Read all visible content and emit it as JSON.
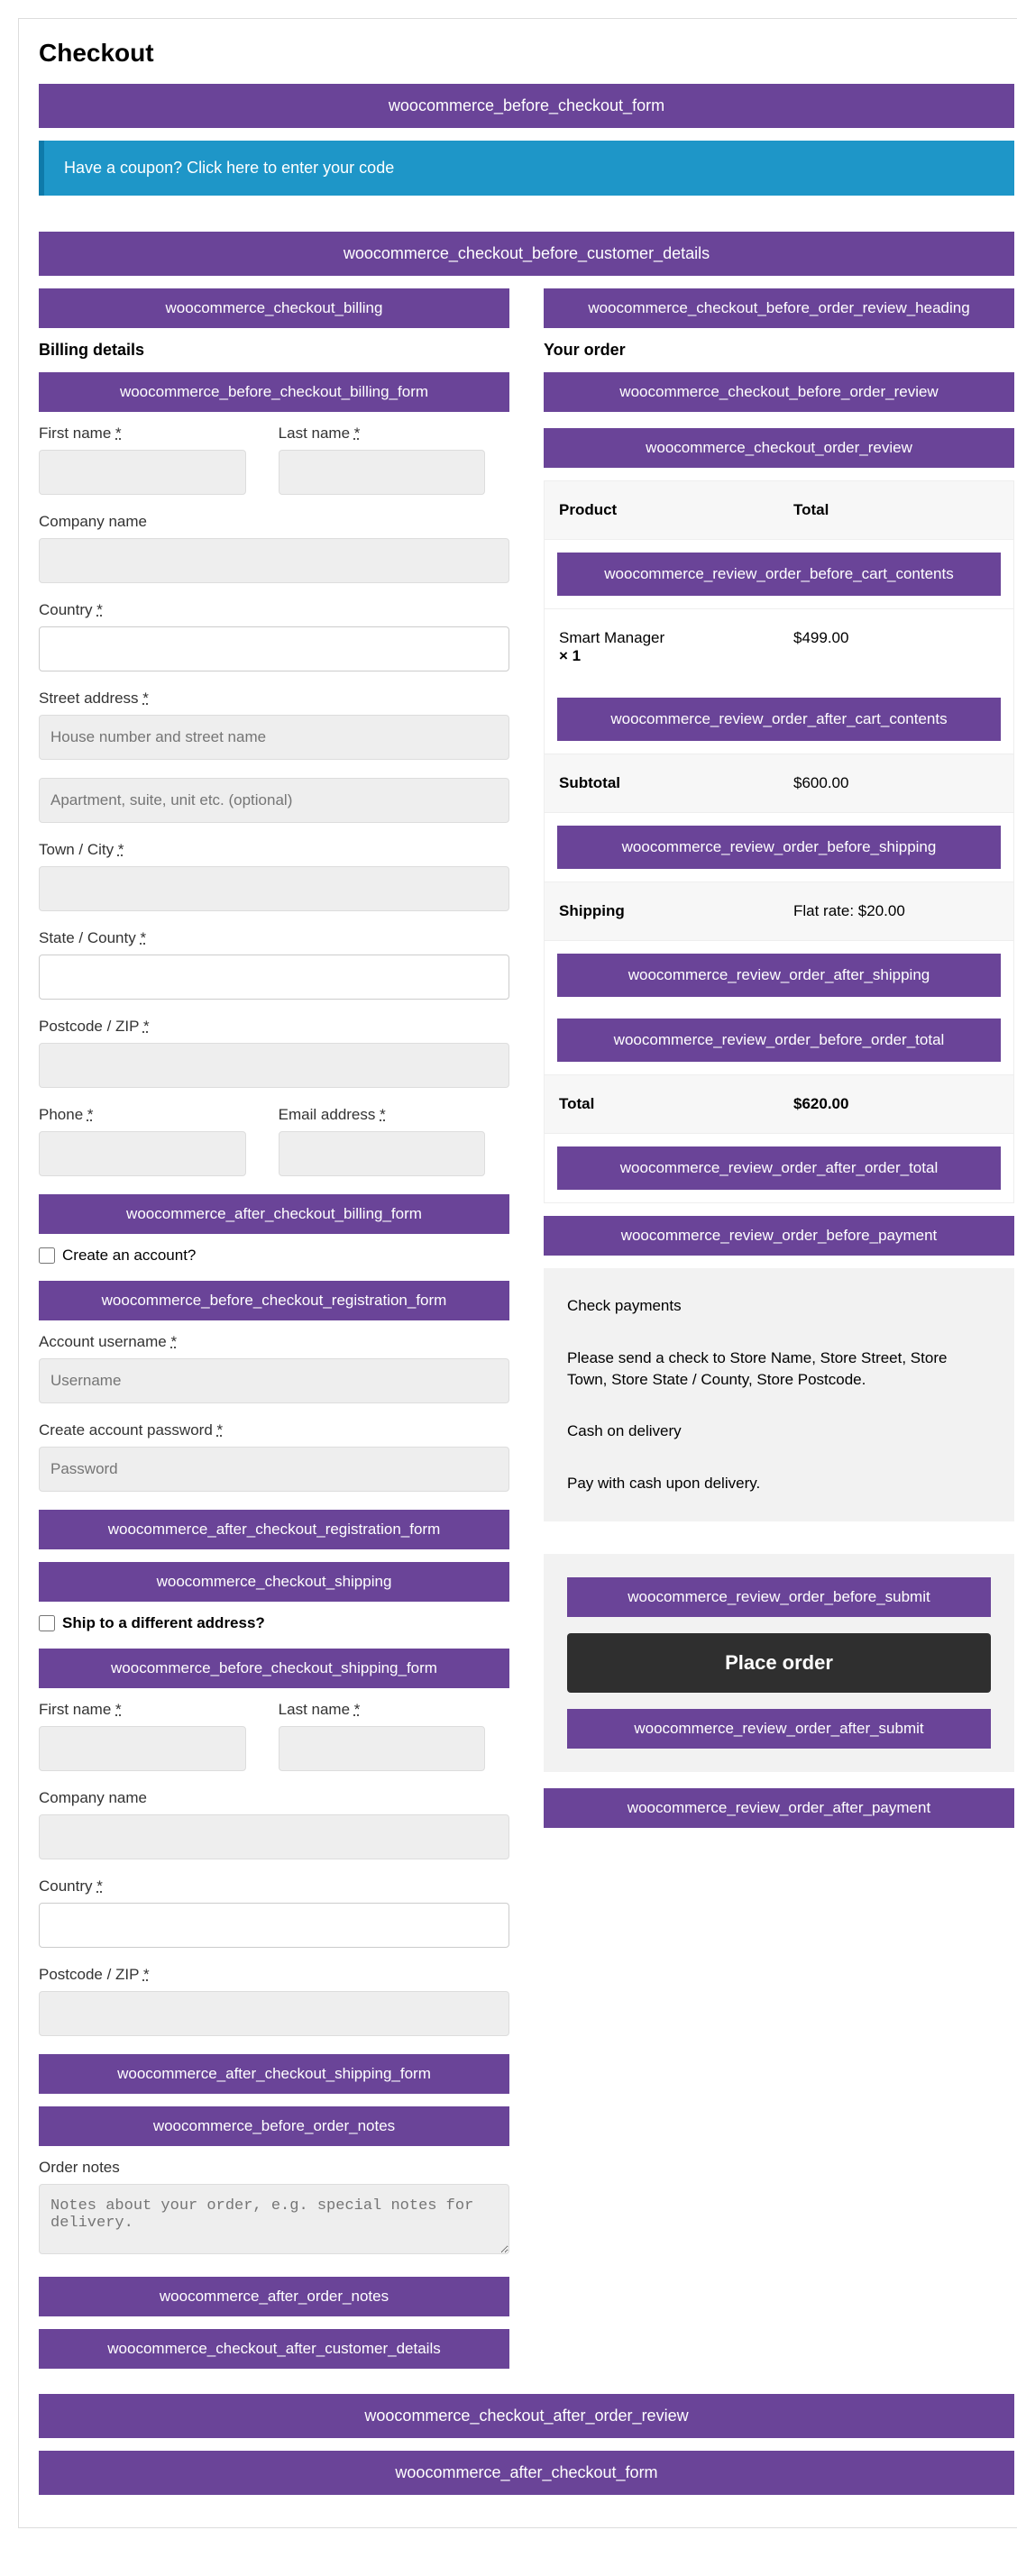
{
  "title": "Checkout",
  "coupon_text": "Have a coupon? Click here to enter your code",
  "hooks": {
    "before_form": "woocommerce_before_checkout_form",
    "before_customer": "woocommerce_checkout_before_customer_details",
    "billing": "woocommerce_checkout_billing",
    "before_billing_form": "woocommerce_before_checkout_billing_form",
    "after_billing_form": "woocommerce_after_checkout_billing_form",
    "before_registration": "woocommerce_before_checkout_registration_form",
    "after_registration": "woocommerce_after_checkout_registration_form",
    "shipping": "woocommerce_checkout_shipping",
    "before_shipping_form": "woocommerce_before_checkout_shipping_form",
    "after_shipping_form": "woocommerce_after_checkout_shipping_form",
    "before_order_notes": "woocommerce_before_order_notes",
    "after_order_notes": "woocommerce_after_order_notes",
    "after_customer": "woocommerce_checkout_after_customer_details",
    "before_review_heading": "woocommerce_checkout_before_order_review_heading",
    "before_review": "woocommerce_checkout_before_order_review",
    "order_review": "woocommerce_checkout_order_review",
    "before_cart": "woocommerce_review_order_before_cart_contents",
    "after_cart": "woocommerce_review_order_after_cart_contents",
    "before_shipping_row": "woocommerce_review_order_before_shipping",
    "after_shipping_row": "woocommerce_review_order_after_shipping",
    "before_total": "woocommerce_review_order_before_order_total",
    "after_total": "woocommerce_review_order_after_order_total",
    "before_payment": "woocommerce_review_order_before_payment",
    "before_submit": "woocommerce_review_order_before_submit",
    "after_submit": "woocommerce_review_order_after_submit",
    "after_payment": "woocommerce_review_order_after_payment",
    "after_review": "woocommerce_checkout_after_order_review",
    "after_form": "woocommerce_after_checkout_form"
  },
  "billing": {
    "heading": "Billing details",
    "first_name": "First name",
    "last_name": "Last name",
    "company": "Company name",
    "country": "Country",
    "street": "Street address",
    "street_ph": "House number and street name",
    "street2_ph": "Apartment, suite, unit etc. (optional)",
    "town": "Town / City",
    "state": "State / County",
    "postcode": "Postcode / ZIP",
    "phone": "Phone",
    "email": "Email address",
    "req": "*"
  },
  "account": {
    "create": "Create an account?",
    "username": "Account username",
    "username_ph": "Username",
    "password": "Create account password",
    "password_ph": "Password"
  },
  "shipping": {
    "ship_diff": "Ship to a different address?",
    "first_name": "First name",
    "last_name": "Last name",
    "company": "Company name",
    "country": "Country",
    "postcode": "Postcode / ZIP"
  },
  "notes": {
    "label": "Order notes",
    "ph": "Notes about your order, e.g. special notes for delivery."
  },
  "order": {
    "heading": "Your order",
    "product_h": "Product",
    "total_h": "Total",
    "product_name": "Smart Manager",
    "product_qty": "× 1",
    "product_total": "$499.00",
    "subtotal_l": "Subtotal",
    "subtotal_v": "$600.00",
    "shipping_l": "Shipping",
    "shipping_v": "Flat rate: $20.00",
    "total_l": "Total",
    "total_v": "$620.00"
  },
  "payment": {
    "check_title": "Check payments",
    "check_desc": "Please send a check to Store Name, Store Street, Store Town, Store State / County, Store Postcode.",
    "cod_title": "Cash on delivery",
    "cod_desc": "Pay with cash upon delivery."
  },
  "place_order": "Place order"
}
